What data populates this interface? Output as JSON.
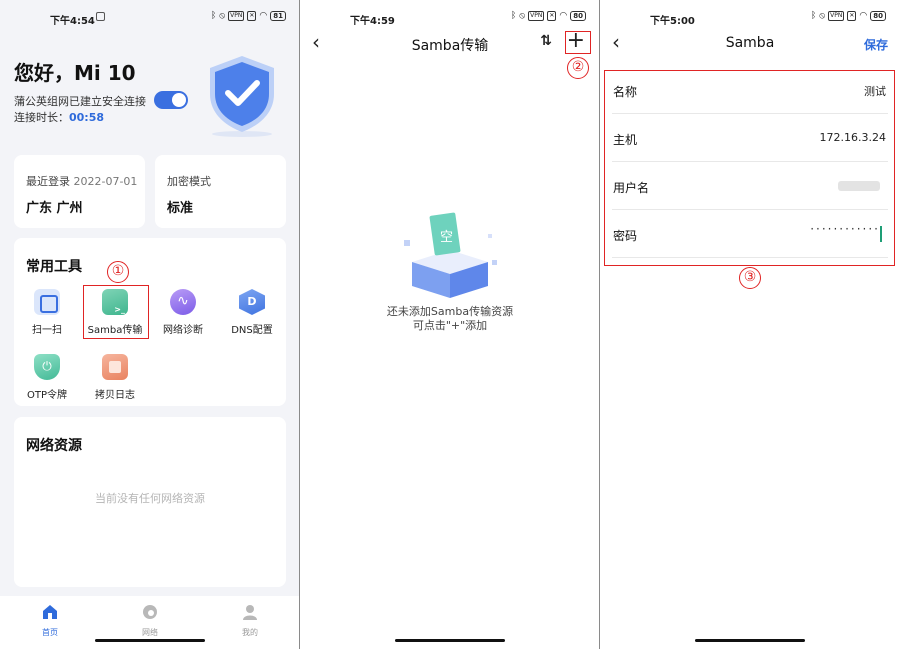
{
  "phone1": {
    "status_time": "下午4:54",
    "battery": "81",
    "greeting": "您好，Mi 10",
    "connection_text": "蒲公英组网已建立安全连接",
    "duration_label": "连接时长：",
    "duration_value": "00:58",
    "last_login_label": "最近登录",
    "last_login_date": "2022-07-01",
    "last_login_location": "广东 广州",
    "encryption_label": "加密模式",
    "encryption_value": "标准",
    "tools_title": "常用工具",
    "tools": [
      {
        "label": "扫一扫",
        "icon": "scan-icon"
      },
      {
        "label": "Samba传输",
        "icon": "samba-icon"
      },
      {
        "label": "网络诊断",
        "icon": "network-diagnose-icon"
      },
      {
        "label": "DNS配置",
        "icon": "dns-icon"
      },
      {
        "label": "OTP令牌",
        "icon": "otp-icon"
      },
      {
        "label": "拷贝日志",
        "icon": "copy-log-icon"
      }
    ],
    "resources_title": "网络资源",
    "resources_empty": "当前没有任何网络资源",
    "tabs": [
      {
        "label": "首页",
        "icon": "home-icon"
      },
      {
        "label": "网络",
        "icon": "network-icon"
      },
      {
        "label": "我的",
        "icon": "user-icon"
      }
    ]
  },
  "phone2": {
    "status_time": "下午4:59",
    "battery": "80",
    "title": "Samba传输",
    "empty_badge": "空",
    "empty_line1": "还未添加Samba传输资源",
    "empty_line2": "可点击\"+\"添加"
  },
  "phone3": {
    "status_time": "下午5:00",
    "battery": "80",
    "title": "Samba",
    "save_label": "保存",
    "fields": [
      {
        "label": "名称",
        "value": "测试"
      },
      {
        "label": "主机",
        "value": "172.16.3.24"
      },
      {
        "label": "用户名",
        "value": ""
      },
      {
        "label": "密码",
        "value": "············"
      }
    ]
  },
  "annotations": [
    "①",
    "②",
    "③"
  ],
  "colors": {
    "accent": "#2f6bdb",
    "annotation": "#e02424",
    "toggle": "#3a6fe0"
  }
}
